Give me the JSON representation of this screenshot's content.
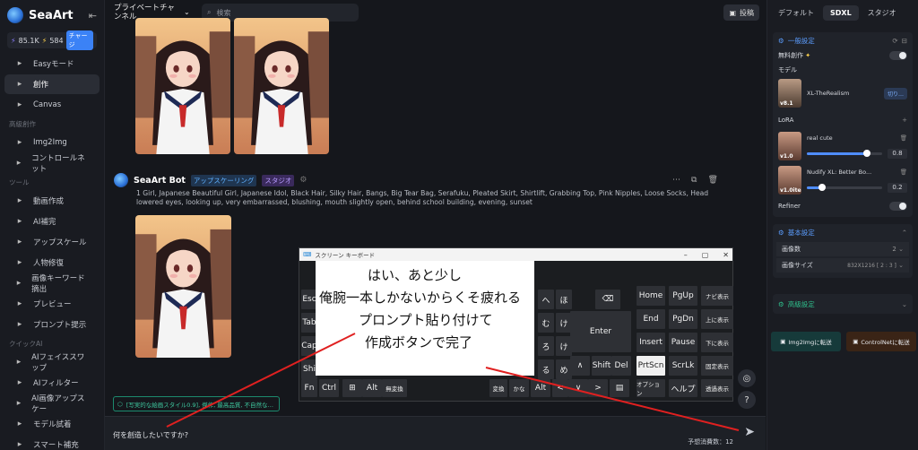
{
  "app": {
    "name": "SeaArt",
    "credits": "85.1K",
    "points": "584",
    "charge_label": "チャージ"
  },
  "sidebar": {
    "items_top": [
      {
        "label": "Easyモード",
        "icon": "sparkle-icon"
      },
      {
        "label": "創作",
        "icon": "play-icon",
        "active": true
      },
      {
        "label": "Canvas",
        "icon": "canvas-icon"
      }
    ],
    "section1": "高級創作",
    "items_mid": [
      {
        "label": "Img2Img",
        "icon": "image-icon"
      },
      {
        "label": "コントロールネット",
        "icon": "control-icon"
      }
    ],
    "section2": "ツール",
    "items_tools": [
      {
        "label": "動画作成",
        "icon": "video-icon"
      },
      {
        "label": "AI補完",
        "icon": "expand-icon"
      },
      {
        "label": "アップスケール",
        "icon": "upscale-icon"
      },
      {
        "label": "人物修復",
        "icon": "face-icon"
      },
      {
        "label": "画像キーワード摘出",
        "icon": "keyword-icon"
      },
      {
        "label": "プレビュー",
        "icon": "preview-icon"
      },
      {
        "label": "プロンプト提示",
        "icon": "prompt-icon"
      }
    ],
    "section3": "クイックAI",
    "items_quick": [
      {
        "label": "AIフェイススワップ",
        "icon": "swap-icon"
      },
      {
        "label": "AIフィルター",
        "icon": "filter-icon"
      },
      {
        "label": "AI画像アップスケー",
        "icon": "upscale-icon"
      },
      {
        "label": "モデル試着",
        "icon": "model-icon"
      },
      {
        "label": "スマート補充",
        "icon": "fill-icon"
      }
    ]
  },
  "topbar": {
    "channel": "プライベートチャンネル",
    "search_placeholder": "検索",
    "post_label": "投稿"
  },
  "message": {
    "bot_name": "SeaArt Bot",
    "tag_upscale": "アップスケーリング",
    "tag_studio": "スタジオ",
    "prompt": "1 Girl, Japanese Beautiful Girl, Japanese Idol, Black Hair, Silky Hair, Bangs, Big Tear Bag, Serafuku, Pleated Skirt, Shirtlift, Grabbing Top, Pink Nipples, Loose Socks, Head lowered eyes, looking up, very embarrassed, blushing, mouth slightly open, behind school building, evening, sunset"
  },
  "bottom": {
    "style_chip": "[写実的な絵画スタイル0.9], 傑作, 最高品質, 不自然な…",
    "input_placeholder": "何を創造したいですか?",
    "estimate": "予想消費数：12"
  },
  "right_panel": {
    "tabs": [
      "デフォルト",
      "SDXL",
      "スタジオ"
    ],
    "general_title": "一般設定",
    "free_create": "無料創作",
    "model_label": "モデル",
    "model_name": "XL-TheRealism",
    "model_version": "v8.1",
    "switch_label": "切り…",
    "lora_label": "LoRA",
    "loras": [
      {
        "name": "real cute",
        "version": "v1.0",
        "value": "0.8",
        "level": 0.8
      },
      {
        "name": "Nudify XL: Better Bo...",
        "version": "v1.0ite",
        "value": "0.2",
        "level": 0.2
      }
    ],
    "refiner_label": "Refiner",
    "basic_title": "基本設定",
    "image_count_label": "画像数",
    "image_count_value": "2",
    "image_size_label": "画像サイズ",
    "image_size_value": "832X1216  [ 2 : 3 ]",
    "advanced_title": "高級設定",
    "img2img_btn": "Img2Imgに転送",
    "controlnet_btn": "ControlNetに転送"
  },
  "keyboard": {
    "title": "スクリーン キーボード",
    "keys": {
      "esc": "Esc",
      "tab": "Tab",
      "caps": "Cap",
      "shift": "Shi",
      "fn": "Fn",
      "ctrl": "Ctrl",
      "alt": "Alt",
      "muhenkan": "無変換",
      "henkan": "変換",
      "kana": "かな",
      "alt2": "Alt",
      "enter": "Enter",
      "shift2": "Shift",
      "del": "Del",
      "home": "Home",
      "pgup": "PgUp",
      "navi": "ナビ表示",
      "end": "End",
      "pgdn": "PgDn",
      "up_move": "上に表示",
      "insert": "Insert",
      "pause": "Pause",
      "down_move": "下に表示",
      "prtscn": "PrtScn",
      "scrlk": "ScrLk",
      "fixed": "固定表示",
      "option": "オプション",
      "help": "ヘルプ",
      "transparent": "透過表示",
      "jp1": "へ",
      "jp2": "ほ",
      "jp3": "む",
      "jp4": "け",
      "jp5": "ろ",
      "jp6": "け",
      "jp7": "る",
      "jp8": "め",
      "jp9": "ね",
      "jp10": "め"
    }
  },
  "annotation": {
    "line1": "はい、あと少し",
    "line2": "俺腕一本しかないからくそ疲れる",
    "line3": "プロンプト貼り付けて",
    "line4": "作成ボタンで完了"
  },
  "colors": {
    "accent": "#4f8dff",
    "bg": "#15171c",
    "annotation_line": "#e02020"
  }
}
